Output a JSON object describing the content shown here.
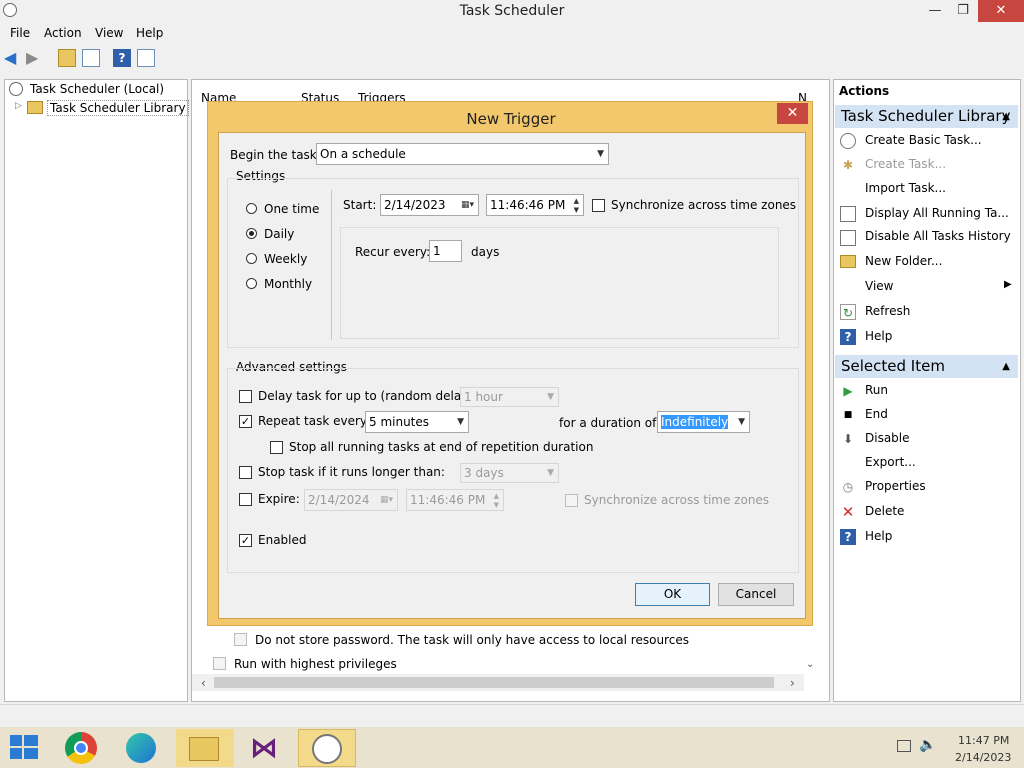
{
  "app": {
    "title": "Task Scheduler"
  },
  "window_controls": {
    "minimize": "—",
    "restore": "❐",
    "close": "✕"
  },
  "menu": [
    "File",
    "Action",
    "View",
    "Help"
  ],
  "tree": {
    "root": "Task Scheduler (Local)",
    "library": "Task Scheduler Library"
  },
  "center": {
    "col_name": "Name",
    "col_status": "Status",
    "col_triggers": "Triggers",
    "col_extra": "N",
    "store_password": "Do not store password.  The task will only have access to local resources",
    "highest_priv": "Run with highest privileges"
  },
  "actions": {
    "header": "Actions",
    "library_section": "Task Scheduler Library",
    "library_items": [
      "Create Basic Task...",
      "Create Task...",
      "Import Task...",
      "Display All Running Ta...",
      "Disable All Tasks History",
      "New Folder...",
      "View",
      "Refresh",
      "Help"
    ],
    "selected_section": "Selected Item",
    "selected_items": [
      "Run",
      "End",
      "Disable",
      "Export...",
      "Properties",
      "Delete",
      "Help"
    ]
  },
  "dialog": {
    "title": "New Trigger",
    "begin_label": "Begin the task:",
    "begin_value": "On a schedule",
    "settings_label": "Settings",
    "radios": [
      "One time",
      "Daily",
      "Weekly",
      "Monthly"
    ],
    "radio_selected": "Daily",
    "start_label": "Start:",
    "start_date": "2/14/2023",
    "start_time": "11:46:46 PM",
    "sync_label": "Synchronize across time zones",
    "recur_label": "Recur every:",
    "recur_value": "1",
    "recur_unit": "days",
    "advanced_label": "Advanced settings",
    "delay_label": "Delay task for up to (random delay):",
    "delay_value": "1 hour",
    "repeat_label": "Repeat task every:",
    "repeat_value": "5 minutes",
    "duration_label": "for a duration of:",
    "duration_value": "Indefinitely",
    "stop_all_label": "Stop all running tasks at end of repetition duration",
    "stop_longer_label": "Stop task if it runs longer than:",
    "stop_longer_value": "3 days",
    "expire_label": "Expire:",
    "expire_date": "2/14/2024",
    "expire_time": "11:46:46 PM",
    "expire_sync_label": "Synchronize across time zones",
    "enabled_label": "Enabled",
    "checked_repeat": true,
    "checked_enabled": true,
    "ok": "OK",
    "cancel": "Cancel"
  },
  "taskbar": {
    "time": "11:47 PM",
    "date": "2/14/2023"
  },
  "colors": {
    "accent": "#f3c76b",
    "section_header": "#d4e3f3",
    "close_red": "#c7463f"
  }
}
